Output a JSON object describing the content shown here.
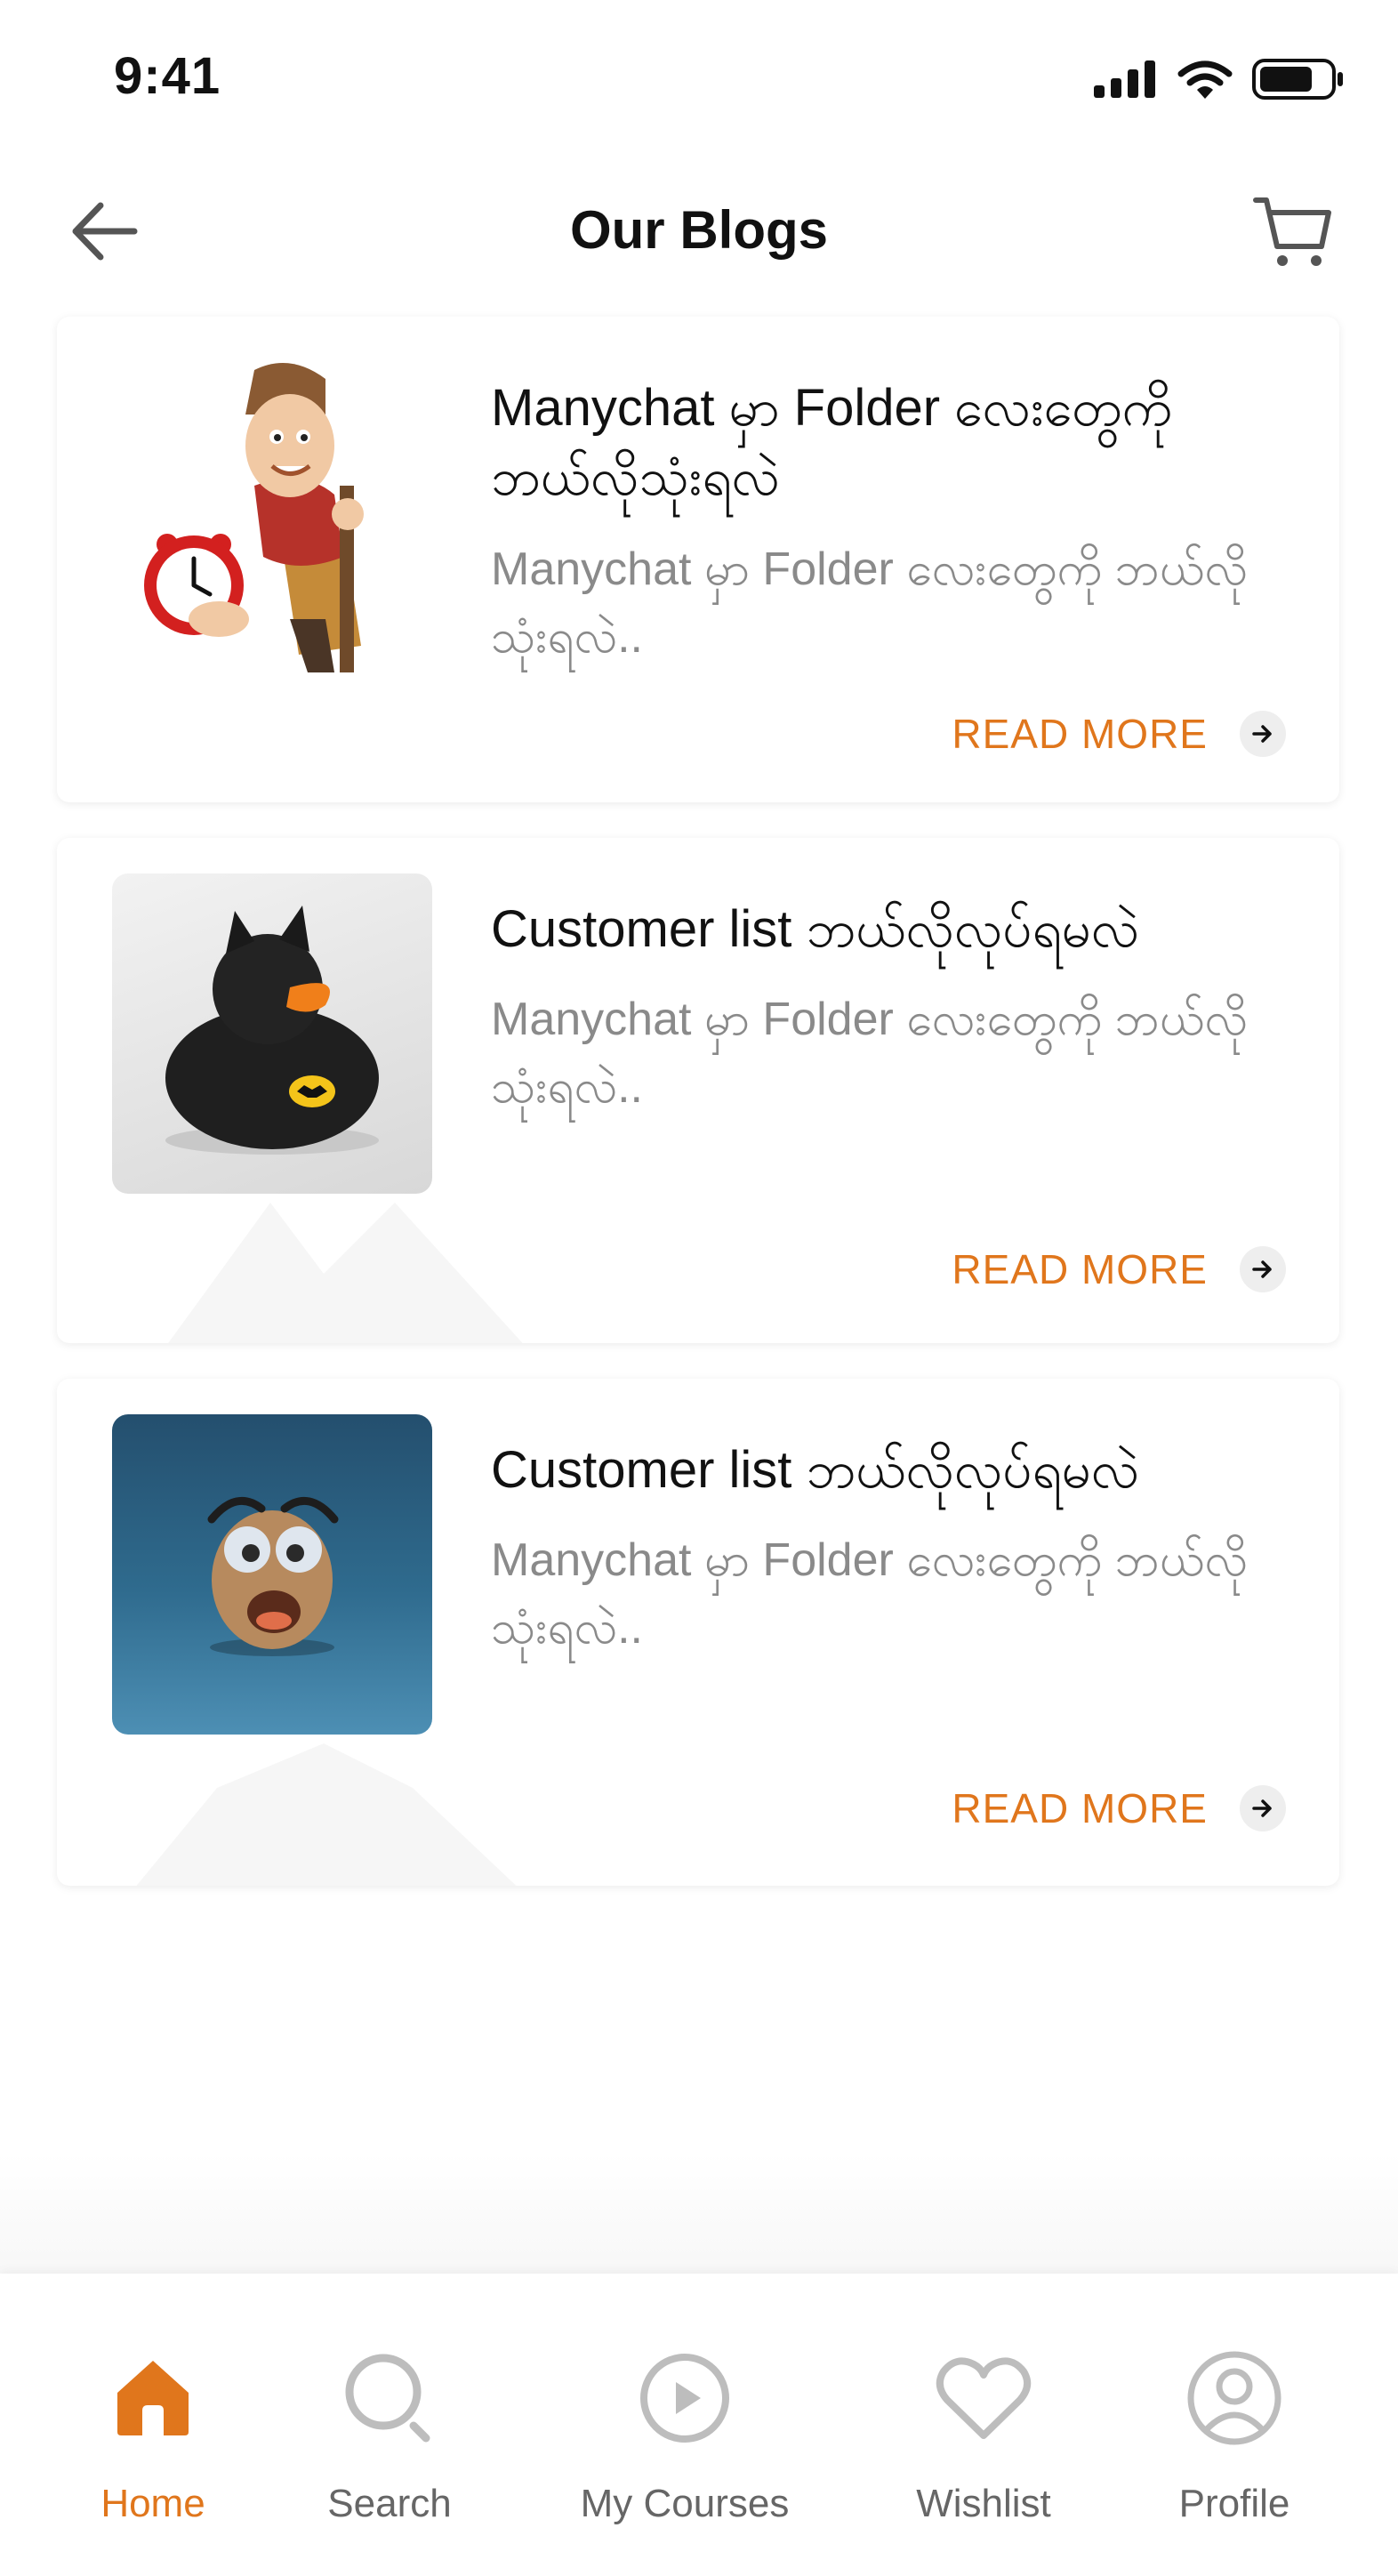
{
  "status_bar": {
    "time": "9:41"
  },
  "header": {
    "title": "Our Blogs"
  },
  "colors": {
    "accent": "#E0761C",
    "muted": "#8a8a8a",
    "icon_gray": "#bdbdbd"
  },
  "posts": [
    {
      "title": "Manychat မှာ Folder လေးတွေကို ဘယ်လိုသုံးရလဲ",
      "excerpt": "Manychat မှာ Folder လေးတွေကို ဘယ်လိုသုံးရလဲ..",
      "read_more": "READ MORE",
      "image": "cartoon-man-with-alarm-clock"
    },
    {
      "title": "Customer list ဘယ်လိုလုပ်ရမလဲ",
      "excerpt": "Manychat မှာ Folder လေးတွေကို ဘယ်လိုသုံးရလဲ..",
      "read_more": "READ MORE",
      "image": "batman-rubber-duck"
    },
    {
      "title": "Customer list ဘယ်လိုလုပ်ရမလဲ",
      "excerpt": "Manychat မှာ Folder လေးတွေကို ဘယ်လိုသုံးရလဲ..",
      "read_more": "READ MORE",
      "image": "surprised-egg-character"
    }
  ],
  "tabbar": {
    "items": [
      {
        "label": "Home",
        "icon": "home-icon",
        "active": true
      },
      {
        "label": "Search",
        "icon": "search-icon",
        "active": false
      },
      {
        "label": "My Courses",
        "icon": "play-circle-icon",
        "active": false
      },
      {
        "label": "Wishlist",
        "icon": "heart-icon",
        "active": false
      },
      {
        "label": "Profile",
        "icon": "user-circle-icon",
        "active": false
      }
    ]
  }
}
